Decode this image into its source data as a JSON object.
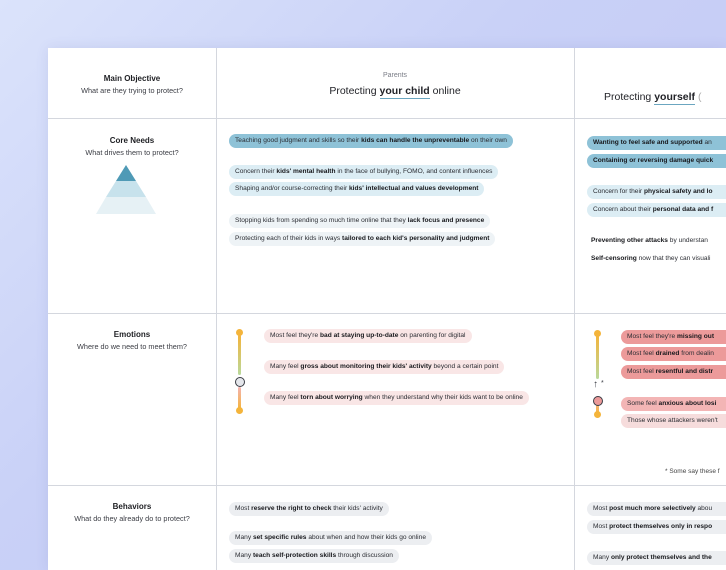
{
  "rows": {
    "objective": {
      "title": "Main Objective",
      "subtitle": "What are they trying to protect?"
    },
    "needs": {
      "title": "Core Needs",
      "subtitle": "What drives them to protect?"
    },
    "emotions": {
      "title": "Emotions",
      "subtitle": "Where do we need to meet them?"
    },
    "behaviors": {
      "title": "Behaviors",
      "subtitle": "What do they already do to protect?"
    }
  },
  "parents": {
    "caption": "Parents",
    "heading_pre": "Protecting ",
    "heading_em": "your child",
    "heading_post": " online",
    "needs": [
      {
        "pre": "Teaching good judgment and skills so their ",
        "bold": "kids can handle the unpreventable",
        "post": " on their own"
      },
      {
        "pre": "Concern their ",
        "bold": "kids' mental health",
        "post": " in the face of bullying, FOMO, and content influences"
      },
      {
        "pre": "Shaping and/or course-correcting their ",
        "bold": "kids' intellectual and values development",
        "post": ""
      },
      {
        "pre": "Stopping kids from spending so much time online that they ",
        "bold": "lack focus and presence",
        "post": ""
      },
      {
        "pre": "Protecting each of their kids in ways ",
        "bold": "tailored to each kid's personality and judgment",
        "post": ""
      }
    ],
    "emotions": [
      {
        "pre": "Most feel they're ",
        "bold": "bad at staying up-to-date",
        "post": " on parenting for digital"
      },
      {
        "pre": "Many feel ",
        "bold": "gross about monitoring their kids' activity",
        "post": " beyond a certain point"
      },
      {
        "pre": "Many feel ",
        "bold": "torn about worrying",
        "post": " when they understand why their kids want to be online"
      }
    ],
    "behaviors": [
      {
        "pre": "Most ",
        "bold": "reserve the right to check",
        "post": " their kids' activity"
      },
      {
        "pre": "Many ",
        "bold": "set specific rules",
        "post": " about when and how their kids go online"
      },
      {
        "pre": "Many ",
        "bold": "teach self-protection skills",
        "post": " through discussion"
      }
    ]
  },
  "self": {
    "heading_pre": "Protecting ",
    "heading_em": "yourself",
    "heading_post": " (",
    "needs": [
      {
        "pre": "",
        "bold": "Wanting to feel safe and supported",
        "post": " an"
      },
      {
        "pre": "",
        "bold": "Containing or reversing damage quick",
        "post": ""
      },
      {
        "pre": "Concern for their ",
        "bold": "physical safety and lo",
        "post": ""
      },
      {
        "pre": "Concern about their ",
        "bold": "personal data and f",
        "post": ""
      },
      {
        "pre": "",
        "bold": "Preventing other attacks",
        "post": " by understan"
      },
      {
        "pre": "",
        "bold": "Self-censoring",
        "post": " now that they can visuali"
      }
    ],
    "emotions": [
      {
        "pre": "Most feel they're ",
        "bold": "missing out",
        "post": ""
      },
      {
        "pre": "Most feel ",
        "bold": "drained",
        "post": " from dealin"
      },
      {
        "pre": "Most feel ",
        "bold": "resentful and distr",
        "post": ""
      },
      {
        "pre": "Some feel ",
        "bold": "anxious about losi",
        "post": ""
      },
      {
        "pre": "Those whose attackers weren't",
        "bold": "",
        "post": ""
      }
    ],
    "note": "* Some say these f",
    "behaviors": [
      {
        "pre": "Most ",
        "bold": "post much more selectively",
        "post": " abou"
      },
      {
        "pre": "Most ",
        "bold": "protect themselves only in respo",
        "post": ""
      },
      {
        "pre": "Many ",
        "bold": "only protect themselves and the",
        "post": ""
      }
    ]
  },
  "colors": {
    "accent_blue": "#8ec2d7",
    "accent_red": "#ec9a9a",
    "dot_orange": "#f4b43b"
  }
}
